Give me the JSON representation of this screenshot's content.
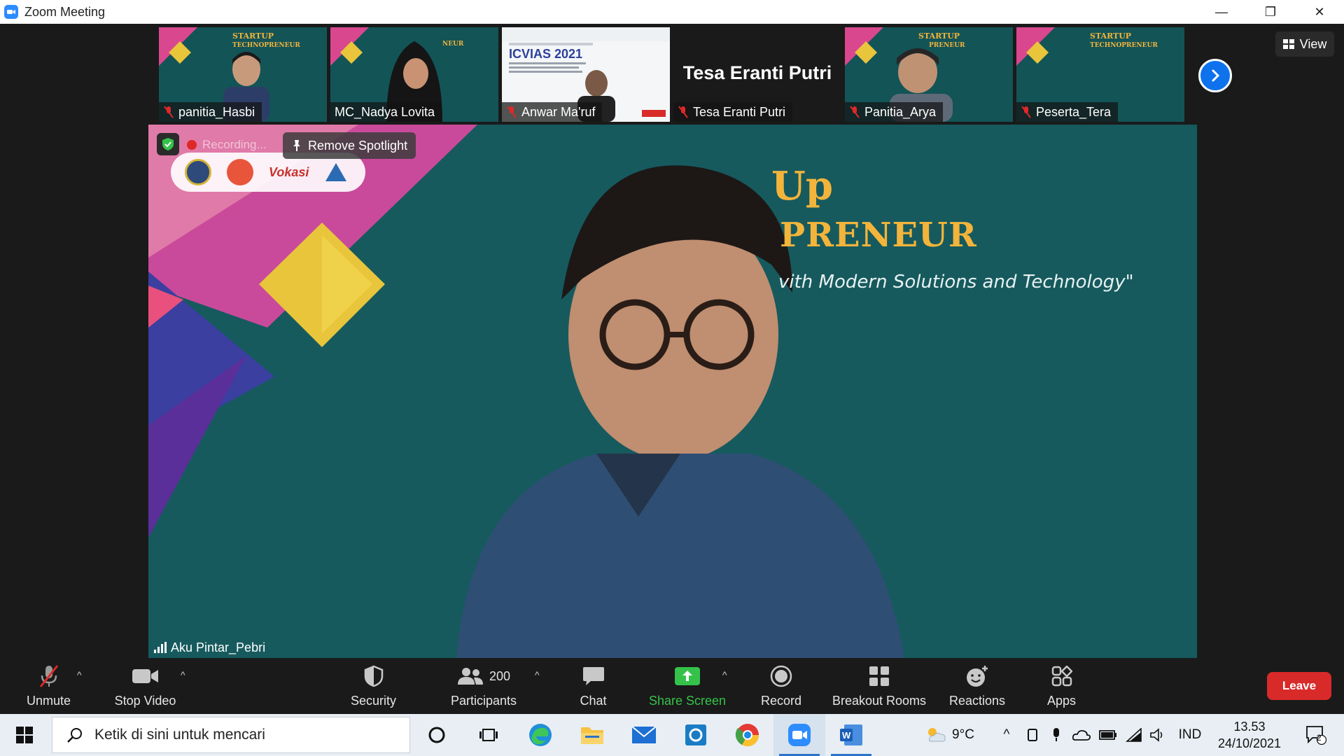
{
  "window": {
    "title": "Zoom Meeting",
    "minimize": "—",
    "maximize": "❐",
    "close": "✕"
  },
  "gallery": {
    "participants": [
      {
        "name": "panitia_Hasbi",
        "muted": true
      },
      {
        "name": "MC_Nadya Lovita",
        "muted": false
      },
      {
        "name": "Anwar Ma'ruf",
        "muted": true
      },
      {
        "name": "Tesa Eranti Putri",
        "muted": true,
        "video_off": true,
        "display_name": "Tesa Eranti Putri"
      },
      {
        "name": "Panitia_Arya",
        "muted": true
      },
      {
        "name": "Peserta_Tera",
        "muted": true
      }
    ],
    "thumb_title_text": "ICVIAS 2021",
    "view_label": "View"
  },
  "main": {
    "recording_label": "Recording...",
    "remove_spotlight_label": "Remove Spotlight",
    "logo_text": "Vokasi",
    "speaker_name": "Aku Pintar_Pebri",
    "background": {
      "title": "Up",
      "subtitle": "PRENEUR",
      "tagline": "vith Modern Solutions and Technology\""
    }
  },
  "toolbar": {
    "unmute": "Unmute",
    "stop_video": "Stop Video",
    "security": "Security",
    "participants": "Participants",
    "participants_count": "200",
    "chat": "Chat",
    "share_screen": "Share Screen",
    "record": "Record",
    "breakout_rooms": "Breakout Rooms",
    "reactions": "Reactions",
    "apps": "Apps",
    "leave": "Leave"
  },
  "taskbar": {
    "search_placeholder": "Ketik di sini untuk mencari",
    "weather": "9°C",
    "language": "IND",
    "time": "13.53",
    "date": "24/10/2021",
    "notification_count": "2"
  },
  "colors": {
    "zoom_blue": "#2D8CFF",
    "leave_red": "#D92A2A",
    "share_green": "#35C24A",
    "teal_bg": "#165A5E"
  }
}
